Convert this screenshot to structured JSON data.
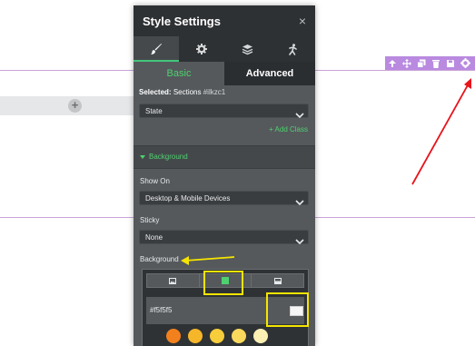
{
  "panel": {
    "title": "Style Settings",
    "close": "×",
    "tabs": {
      "basic": "Basic",
      "advanced": "Advanced"
    },
    "selected_label": "Selected:",
    "selected_value": "Sections",
    "selected_id": "#ilkzc1",
    "state_placeholder": "State",
    "add_class": "+ Add Class",
    "section_title": "Background",
    "show_on_label": "Show On",
    "show_on_value": "Desktop & Mobile Devices",
    "sticky_label": "Sticky",
    "sticky_value": "None",
    "background_label": "Background",
    "color_value": "#f5f5f5"
  },
  "icons": {
    "panel_tabs": [
      "brush-icon",
      "gear-icon",
      "layers-icon",
      "accessibility-icon"
    ],
    "section_toolbar": [
      "arrow-up-icon",
      "move-icon",
      "copy-icon",
      "trash-icon",
      "save-icon",
      "gear-icon"
    ],
    "bg_types": [
      "image-icon",
      "color-icon",
      "gradient-icon"
    ]
  },
  "palette_colors": [
    "#f2811d",
    "#f5b62a",
    "#f7cd3b",
    "#fad95c",
    "#fdf0b5"
  ],
  "colors": {
    "accent": "#4fd16f",
    "panel_bg": "#55595c",
    "panel_dark": "#2e3133",
    "toolbar": "#b98ae0",
    "highlight": "#f5e400",
    "arrow": "#e8141c"
  }
}
